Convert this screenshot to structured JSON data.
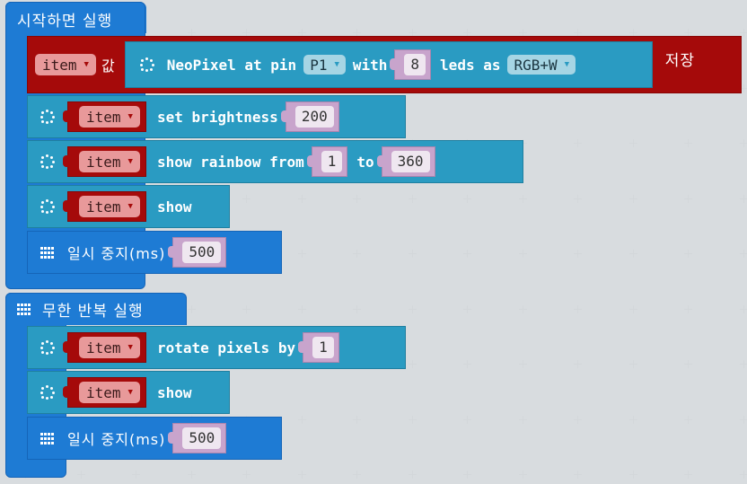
{
  "workspace": {
    "on_start": {
      "header": "시작하면 실행",
      "set_block": {
        "variable": "item",
        "value_label": "값",
        "save_label": "저장",
        "create": {
          "label_prefix": "NeoPixel at pin",
          "pin": "P1",
          "with_label": "with",
          "led_count": "8",
          "leds_as_label": "leds as",
          "mode": "RGB+W"
        }
      },
      "statements": [
        {
          "variable": "item",
          "label": "set brightness",
          "args": [
            "200"
          ]
        },
        {
          "variable": "item",
          "label": "show rainbow from",
          "args": [
            "1"
          ],
          "to_label": "to",
          "to_value": "360"
        },
        {
          "variable": "item",
          "label": "show"
        }
      ],
      "pause": {
        "label": "일시 중지(ms)",
        "value": "500"
      }
    },
    "forever": {
      "header": "무한 반복 실행",
      "statements": [
        {
          "variable": "item",
          "label": "rotate pixels by",
          "args": [
            "1"
          ]
        },
        {
          "variable": "item",
          "label": "show"
        }
      ],
      "pause": {
        "label": "일시 중지(ms)",
        "value": "500"
      }
    }
  },
  "colors": {
    "basic": "#1e7bd4",
    "neopixel": "#2a9bc2",
    "variables": "#a50a0a",
    "math": "#c8a4cc",
    "canvas": "#eceff1"
  }
}
